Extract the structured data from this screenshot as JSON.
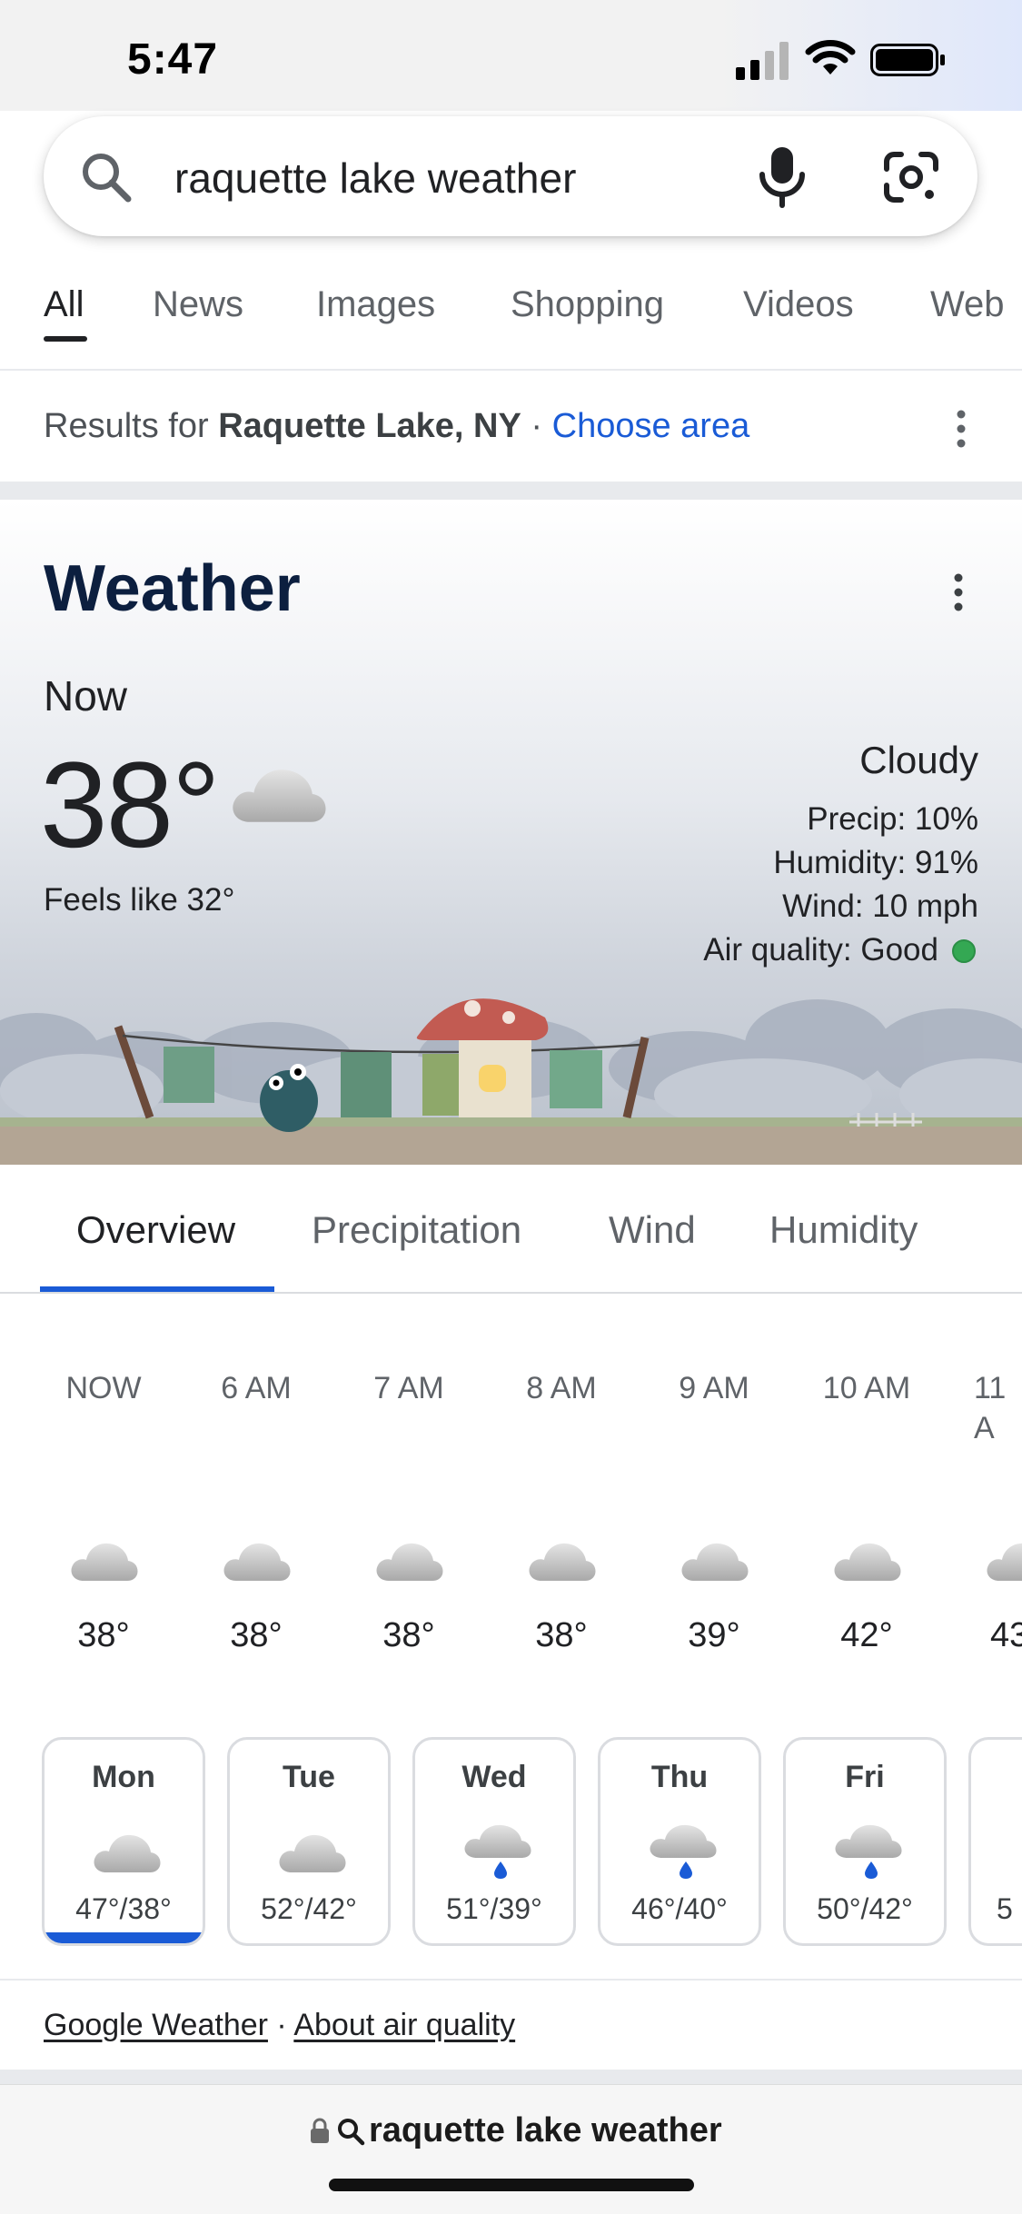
{
  "status_bar": {
    "time": "5:47"
  },
  "search": {
    "query": "raquette lake weather"
  },
  "nav_tabs": [
    "All",
    "News",
    "Images",
    "Shopping",
    "Videos",
    "Web"
  ],
  "results_for": {
    "prefix": "Results for",
    "location": "Raquette Lake, NY",
    "separator": "·",
    "link": "Choose area"
  },
  "weather": {
    "title": "Weather",
    "now_label": "Now",
    "temperature": "38°",
    "feels_like": "Feels like 32°",
    "condition": "Cloudy",
    "precip": "Precip: 10%",
    "humidity": "Humidity: 91%",
    "wind": "Wind: 10 mph",
    "air_quality": "Air quality: Good",
    "air_quality_color": "#34a853"
  },
  "overview_tabs": [
    "Overview",
    "Precipitation",
    "Wind",
    "Humidity"
  ],
  "hourly": [
    {
      "time": "NOW",
      "temp": "38°",
      "icon": "cloud-icon"
    },
    {
      "time": "6 AM",
      "temp": "38°",
      "icon": "cloud-icon"
    },
    {
      "time": "7 AM",
      "temp": "38°",
      "icon": "cloud-icon"
    },
    {
      "time": "8 AM",
      "temp": "38°",
      "icon": "cloud-icon"
    },
    {
      "time": "9 AM",
      "temp": "39°",
      "icon": "cloud-icon"
    },
    {
      "time": "10 AM",
      "temp": "42°",
      "icon": "cloud-icon"
    },
    {
      "time": "11 A",
      "temp": "43",
      "icon": "cloud-icon"
    }
  ],
  "daily": [
    {
      "day": "Mon",
      "temps": "47°/38°",
      "icon": "cloud-icon",
      "selected": true
    },
    {
      "day": "Tue",
      "temps": "52°/42°",
      "icon": "cloud-icon"
    },
    {
      "day": "Wed",
      "temps": "51°/39°",
      "icon": "rain-cloud-icon"
    },
    {
      "day": "Thu",
      "temps": "46°/40°",
      "icon": "rain-cloud-icon"
    },
    {
      "day": "Fri",
      "temps": "50°/42°",
      "icon": "rain-cloud-icon"
    },
    {
      "day": "",
      "temps": "5",
      "icon": ""
    }
  ],
  "footer": {
    "link1": "Google Weather",
    "separator": "·",
    "link2": "About air quality"
  },
  "url_bar": {
    "text": "raquette lake weather"
  },
  "colors": {
    "accent": "#1a5bd6",
    "title": "#0c1f3f"
  }
}
